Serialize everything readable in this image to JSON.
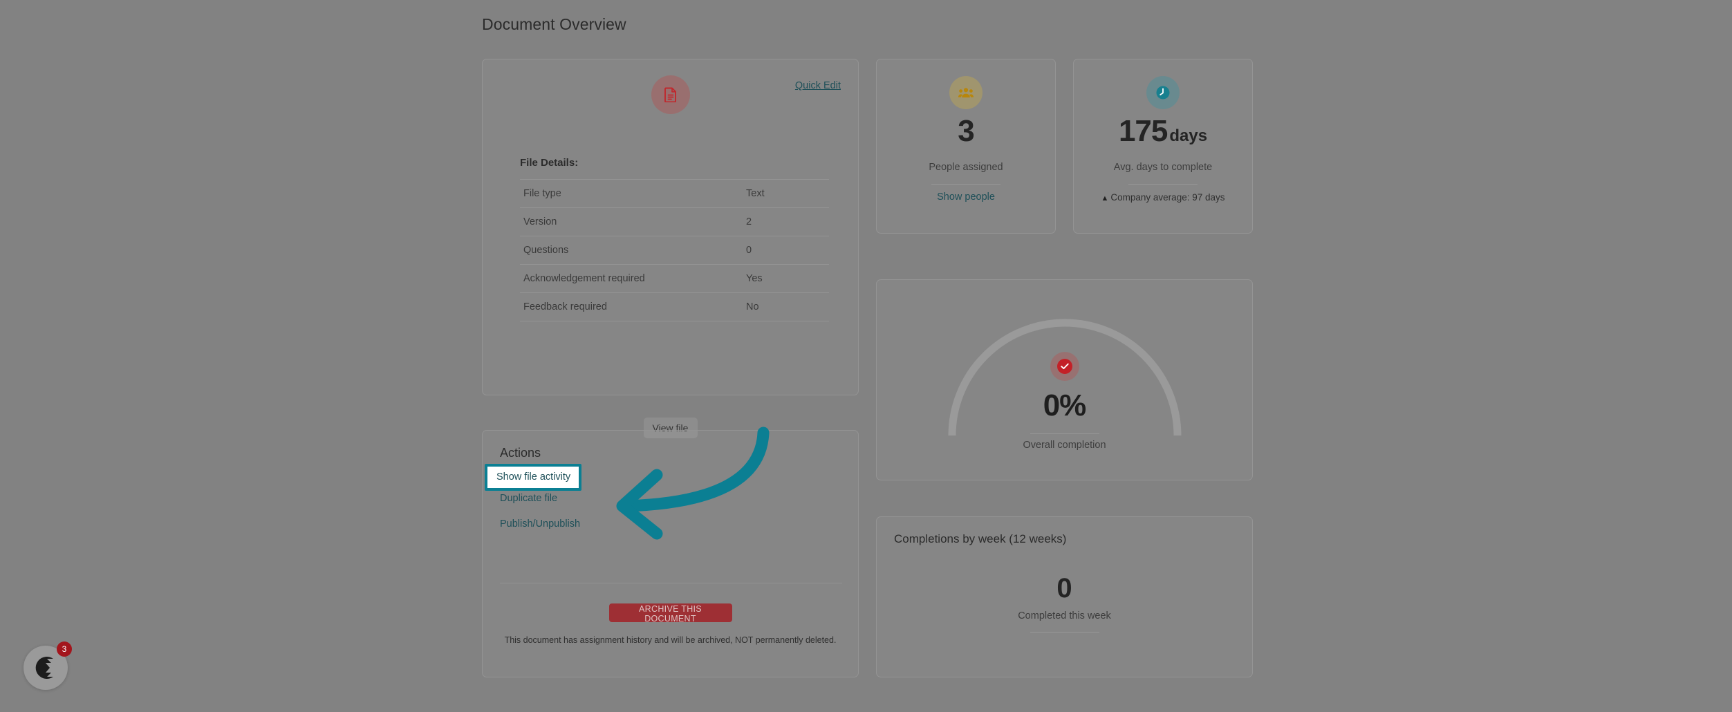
{
  "page": {
    "title": "Document Overview"
  },
  "file_card": {
    "icon": "document-file-icon",
    "quick_edit_label": "Quick Edit",
    "heading": "File Details:",
    "rows": [
      {
        "label": "File type",
        "value": "Text"
      },
      {
        "label": "Version",
        "value": "2"
      },
      {
        "label": "Questions",
        "value": "0"
      },
      {
        "label": "Acknowledgement required",
        "value": "Yes"
      },
      {
        "label": "Feedback required",
        "value": "No"
      }
    ],
    "view_file_label": "View file"
  },
  "actions_card": {
    "heading": "Actions",
    "show_file_activity_label": "Show file activity",
    "duplicate_file_label": "Duplicate file",
    "publish_unpublish_label": "Publish/Unpublish",
    "archive_button_label": "ARCHIVE THIS DOCUMENT",
    "archive_note": "This document has assignment history and will be archived, NOT permanently deleted."
  },
  "people_card": {
    "icon": "people-group-icon",
    "value": "3",
    "label": "People assigned",
    "link_label": "Show people"
  },
  "days_card": {
    "icon": "clock-icon",
    "value": "175",
    "unit": "days",
    "label": "Avg. days to complete",
    "comparison_marker": "▲",
    "comparison": "Company average:  97 days"
  },
  "gauge_card": {
    "icon": "check-circle-icon",
    "value": "0%",
    "label": "Overall completion",
    "percent": 0
  },
  "completions_card": {
    "heading": "Completions by week (12 weeks)",
    "value": "0",
    "label": "Completed this week"
  },
  "chat_widget": {
    "icon": "chat-logo-icon",
    "badge_count": "3"
  },
  "annotation": {
    "arrow": "curved-arrow-pointing-left",
    "target": "show-file-activity-link"
  },
  "colors": {
    "page_background": "#828282",
    "accent_teal": "#0b7f93",
    "link": "#1d4f58",
    "danger": "#9e2f34",
    "highlight_border": "#0b7f93"
  }
}
